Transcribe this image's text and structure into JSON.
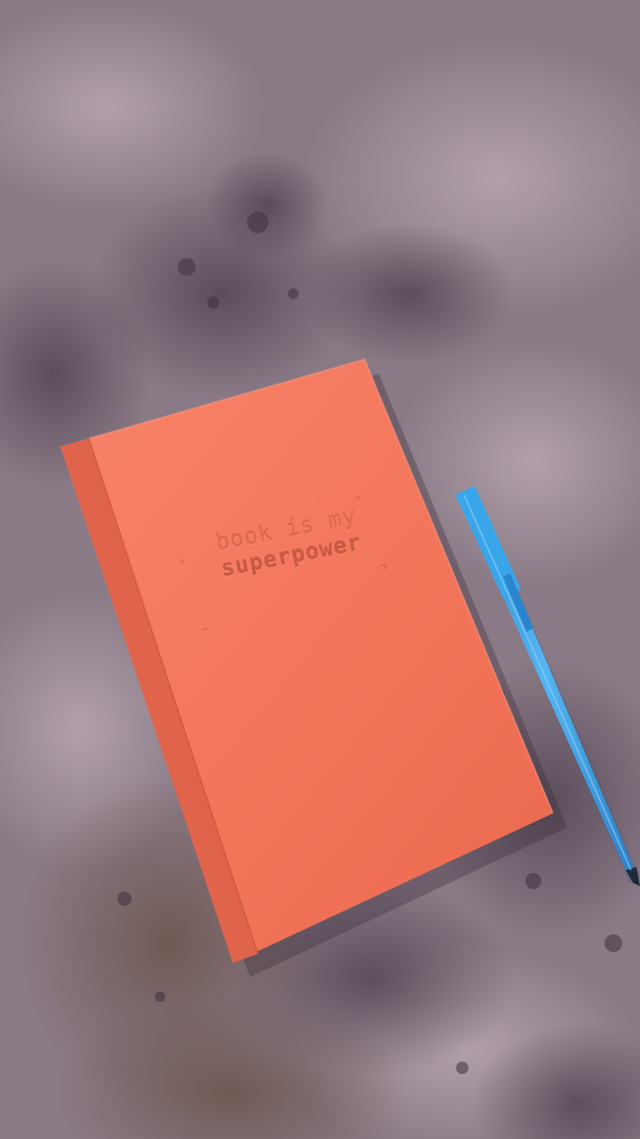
{
  "scene": {
    "description_objects": [
      "notebook",
      "pen"
    ],
    "colors": {
      "surface": "#8a7a86",
      "surface_dark": "#5e4f5c",
      "surface_light": "#b3a3ab",
      "notebook_cover": "#f37a5e",
      "notebook_spine": "#e2674d",
      "pen_body": "#3aa2e3",
      "pen_cap": "#2f8fd6"
    }
  },
  "notebook": {
    "cover_line1": "book is my",
    "cover_line2": "superpower"
  }
}
